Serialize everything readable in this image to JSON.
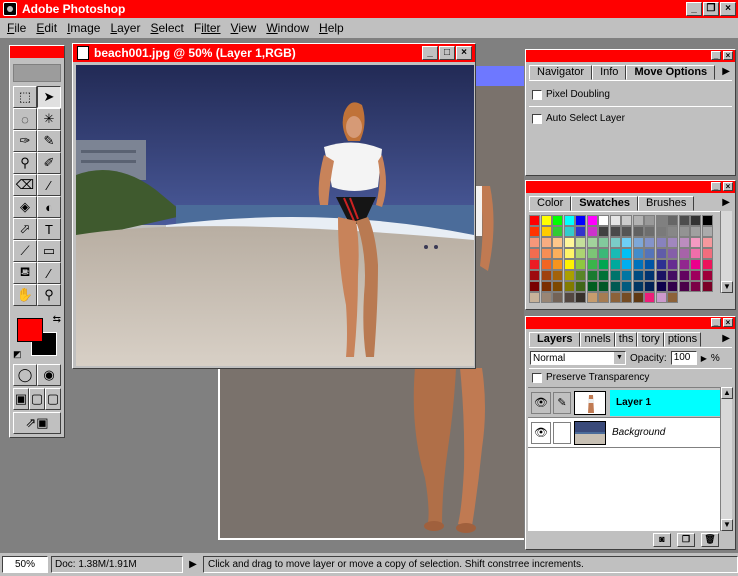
{
  "app": {
    "title": "Adobe Photoshop"
  },
  "menu": [
    {
      "key": "F",
      "rest": "ile"
    },
    {
      "key": "E",
      "rest": "dit"
    },
    {
      "key": "I",
      "rest": "mage"
    },
    {
      "key": "L",
      "rest": "ayer"
    },
    {
      "key": "S",
      "rest": "elect"
    },
    {
      "key": "F",
      "rest": "ilter"
    },
    {
      "key": "V",
      "rest": "iew"
    },
    {
      "key": "W",
      "rest": "indow"
    },
    {
      "key": "H",
      "rest": "elp"
    }
  ],
  "window_buttons": {
    "minimize": "_",
    "restore": "❐",
    "close": "×"
  },
  "document": {
    "title": "beach001.jpg @ 50% (Layer 1,RGB)",
    "buttons": {
      "minimize": "_",
      "maximize": "□",
      "close": "×"
    }
  },
  "navigator_palette": {
    "tabs": [
      "Navigator",
      "Info",
      "Move Options"
    ],
    "active_tab": "Move Options",
    "options": [
      "Pixel Doubling",
      "Auto Select Layer"
    ]
  },
  "swatches_palette": {
    "tabs": [
      "Color",
      "Swatches",
      "Brushes"
    ],
    "active_tab": "Swatches",
    "colors": [
      "#ff0000",
      "#ffff00",
      "#00ff00",
      "#00ffff",
      "#0000ff",
      "#ff00ff",
      "#ffffff",
      "#e6e6e6",
      "#cccccc",
      "#b3b3b3",
      "#999999",
      "#808080",
      "#666666",
      "#4d4d4d",
      "#333333",
      "#000000",
      "#ff3300",
      "#ffcc00",
      "#33cc33",
      "#33cccc",
      "#3333cc",
      "#cc33cc",
      "#404040",
      "#4a4a4a",
      "#555555",
      "#616161",
      "#6e6e6e",
      "#7a7a7a",
      "#878787",
      "#939393",
      "#a0a0a0",
      "#ababab",
      "#f7977a",
      "#f9ad81",
      "#fdc68a",
      "#fff79a",
      "#c4df9b",
      "#a2d39c",
      "#82ca9d",
      "#7bcdc8",
      "#6ecff6",
      "#7ea7d8",
      "#8493ca",
      "#8882be",
      "#a187be",
      "#bc8dbf",
      "#f49ac2",
      "#f6989d",
      "#f26c4f",
      "#f68e55",
      "#fbaf5c",
      "#fff467",
      "#acd372",
      "#7cc576",
      "#3bb878",
      "#1abbb4",
      "#00bff3",
      "#438cca",
      "#5574b9",
      "#605ca8",
      "#855fa8",
      "#a763a8",
      "#f06eaa",
      "#f26d7d",
      "#ed1c24",
      "#f26522",
      "#f7941d",
      "#fff200",
      "#8dc73f",
      "#39b54a",
      "#00a651",
      "#00a99d",
      "#00aeef",
      "#0072bc",
      "#0054a6",
      "#2e3192",
      "#662d91",
      "#92278f",
      "#ec008c",
      "#ed145b",
      "#9e0b0f",
      "#a0410d",
      "#a3620a",
      "#aba000",
      "#598527",
      "#1a7b30",
      "#007236",
      "#00746b",
      "#0076a3",
      "#004b80",
      "#003471",
      "#1b1464",
      "#440e62",
      "#630460",
      "#9e005d",
      "#9e0039",
      "#790000",
      "#7b2e00",
      "#7d4900",
      "#827b00",
      "#406618",
      "#005e20",
      "#005826",
      "#005952",
      "#005b7f",
      "#003663",
      "#002157",
      "#0d004c",
      "#32004b",
      "#4b0049",
      "#7b0046",
      "#7a0026",
      "#c7b299",
      "#998675",
      "#736357",
      "#534741",
      "#37302a",
      "#c69c6d",
      "#a67c52",
      "#8c6239",
      "#754c24",
      "#603913",
      "#ed1e79",
      "#cc99cc",
      "#8c6239"
    ]
  },
  "layers_palette": {
    "tabs": [
      "Layers",
      "nnels",
      "ths",
      "tory",
      "ptions"
    ],
    "active_tab": "Layers",
    "blend_mode": "Normal",
    "opacity_label": "Opacity:",
    "opacity_value": "100",
    "opacity_unit": "%",
    "preserve_label": "Preserve Transparency",
    "layers": [
      {
        "name": "Layer 1",
        "selected": true,
        "italic": false
      },
      {
        "name": "Background",
        "selected": false,
        "italic": true
      }
    ]
  },
  "status": {
    "zoom": "50%",
    "doc": "Doc: 1.38M/1.91M",
    "message": "Click and drag to move layer or move a copy of selection. Shift constrree increments."
  },
  "colors": {
    "title_red": "#ff0000",
    "ui_gray": "#c0c0c0",
    "foreground": "#ff0000",
    "background": "#000000",
    "layer_highlight": "#00ffff"
  }
}
